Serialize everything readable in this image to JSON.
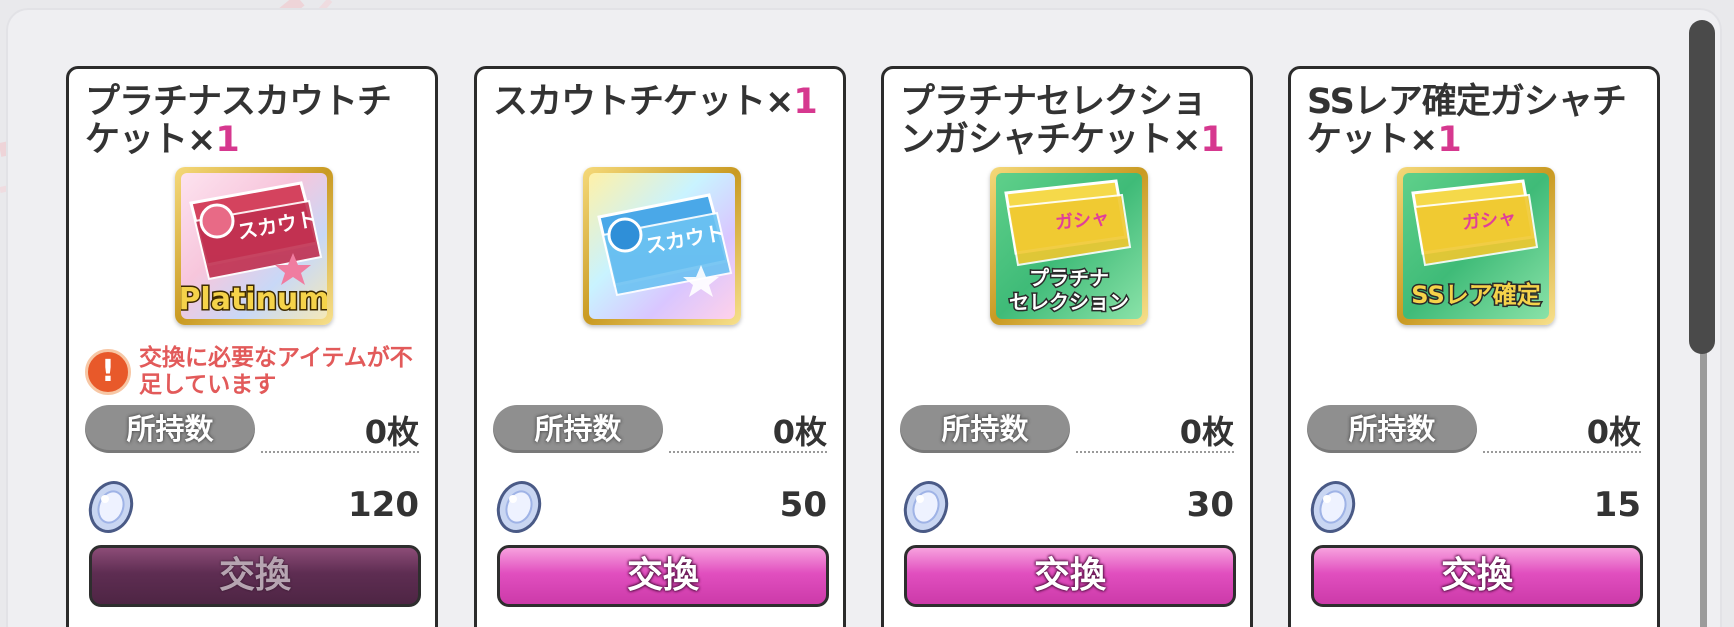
{
  "owned_label": "所持数",
  "exchange_label": "交換",
  "warning": {
    "icon": "exclamation-icon",
    "mark": "!",
    "text": "交換に必要なアイテムが不足しています"
  },
  "cards": [
    {
      "title": "プラチナスカウトチケット×",
      "qty": "1",
      "icon_name": "platinum-scout-ticket-icon",
      "icon_text": "スカウト",
      "icon_caption": "Platinum",
      "owned": "0枚",
      "cost": "120",
      "exchange_enabled": false
    },
    {
      "title": "スカウトチケット×",
      "qty": "1",
      "icon_name": "scout-ticket-icon",
      "icon_text": "スカウト",
      "owned": "0枚",
      "cost": "50",
      "exchange_enabled": true
    },
    {
      "title": "プラチナセレクションガシャチケット×",
      "qty": "1",
      "icon_name": "platinum-selection-gacha-ticket-icon",
      "icon_text": "ガシャ",
      "icon_caption_1": "プラチナ",
      "icon_caption_2": "セレクション",
      "owned": "0枚",
      "cost": "30",
      "exchange_enabled": true
    },
    {
      "title": "SSレア確定ガシャチケット×",
      "qty": "1",
      "icon_name": "ss-rare-gacha-ticket-icon",
      "icon_text": "ガシャ",
      "icon_caption": "SSレア確定",
      "owned": "0枚",
      "cost": "15",
      "exchange_enabled": true
    }
  ],
  "colors": {
    "accent_pink": "#e14fbf",
    "qty_pink": "#d6388f",
    "warning_red": "#e25a5a",
    "disabled_button": "#5e2d52"
  }
}
